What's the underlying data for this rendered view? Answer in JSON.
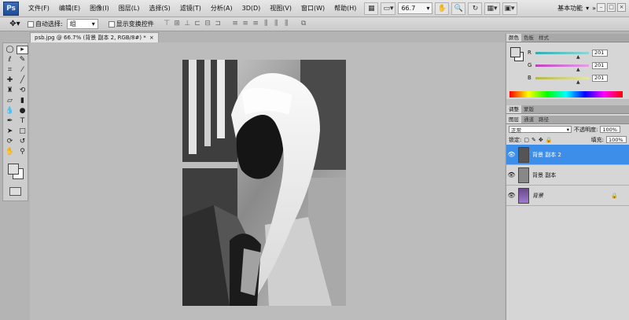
{
  "app": {
    "logo": "Ps",
    "menus": [
      "文件(F)",
      "编辑(E)",
      "图像(I)",
      "图层(L)",
      "选择(S)",
      "滤镜(T)",
      "分析(A)",
      "3D(D)",
      "视图(V)",
      "窗口(W)",
      "帮助(H)"
    ],
    "zoom": "66.7",
    "workspace": "基本功能",
    "window_controls": [
      "–",
      "□",
      "×"
    ]
  },
  "options": {
    "auto_select_label": "自动选择:",
    "auto_select_value": "组",
    "show_transform_label": "显示变换控件"
  },
  "document": {
    "tab_title": "psb.jpg @ 66.7% (背景 副本 2, RGB/8#) *",
    "close": "×"
  },
  "color_panel": {
    "tabs": [
      "颜色",
      "色板",
      "样式"
    ],
    "channels": [
      {
        "label": "R",
        "value": "201",
        "color": "#2fb0b0"
      },
      {
        "label": "G",
        "value": "201",
        "color": "#c040c0"
      },
      {
        "label": "B",
        "value": "201",
        "color": "#b8b84a"
      }
    ]
  },
  "adjust_tabs": [
    "调整",
    "蒙版"
  ],
  "layers_panel": {
    "tabs": [
      "图层",
      "通道",
      "路径"
    ],
    "blend_mode": "正常",
    "opacity_label": "不透明度:",
    "opacity": "100%",
    "lock_label": "锁定:",
    "fill_label": "填充:",
    "fill": "100%",
    "layers": [
      {
        "name": "背景 副本 2",
        "selected": true
      },
      {
        "name": "背景 副本",
        "selected": false
      },
      {
        "name": "背景",
        "selected": false,
        "locked": true
      }
    ]
  },
  "colors": {
    "selection": "#3d8ee9",
    "ps_blue": "#2a5ba8"
  }
}
